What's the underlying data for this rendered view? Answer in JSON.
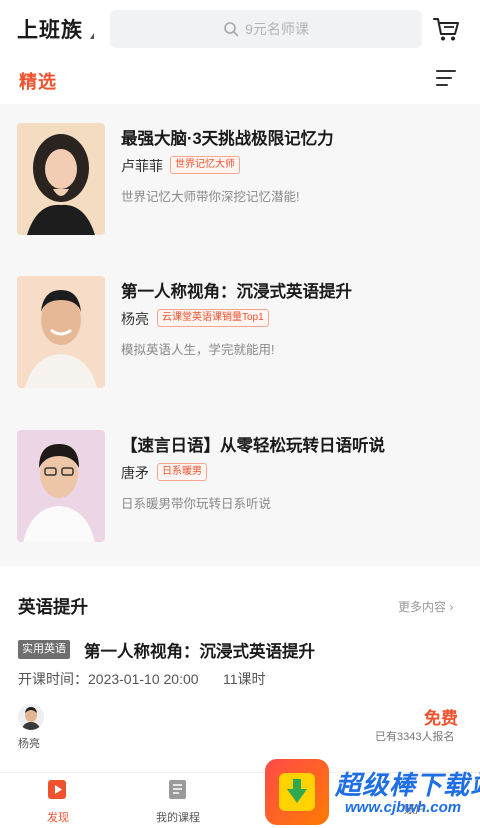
{
  "header": {
    "city": "上班族",
    "search_placeholder": "9元名师课"
  },
  "tabs": {
    "active": "精选"
  },
  "courses": [
    {
      "title": "最强大脑·3天挑战极限记忆力",
      "teacher": "卢菲菲",
      "badge": "世界记忆大师",
      "desc": "世界记忆大师带你深挖记忆潜能!"
    },
    {
      "title": "第一人称视角：沉浸式英语提升",
      "teacher": "杨亮",
      "badge": "云课堂英语课销量Top1",
      "desc": "模拟英语人生，学完就能用!"
    },
    {
      "title": "【速言日语】从零轻松玩转日语听说",
      "teacher": "唐矛",
      "badge": "日系暖男",
      "desc": "日系暖男带你玩转日系听说"
    }
  ],
  "section": {
    "title": "英语提升",
    "more": "更多内容",
    "tag": "实用英语",
    "course_title": "第一人称视角：沉浸式英语提升",
    "time": "开课时间：2023-01-10 20:00",
    "lessons": "11课时",
    "teacher": "杨亮",
    "price": "免费",
    "enrolled": "已有3343人报名"
  },
  "bottom_nav": {
    "discover": "发现",
    "my_courses": "我的课程",
    "me": "账户"
  },
  "watermark": {
    "text": "超级棒下载站",
    "url": "www.cjbwh.com"
  },
  "colors": {
    "accent": "#f0522e",
    "watermark": "#1e6ee6"
  }
}
